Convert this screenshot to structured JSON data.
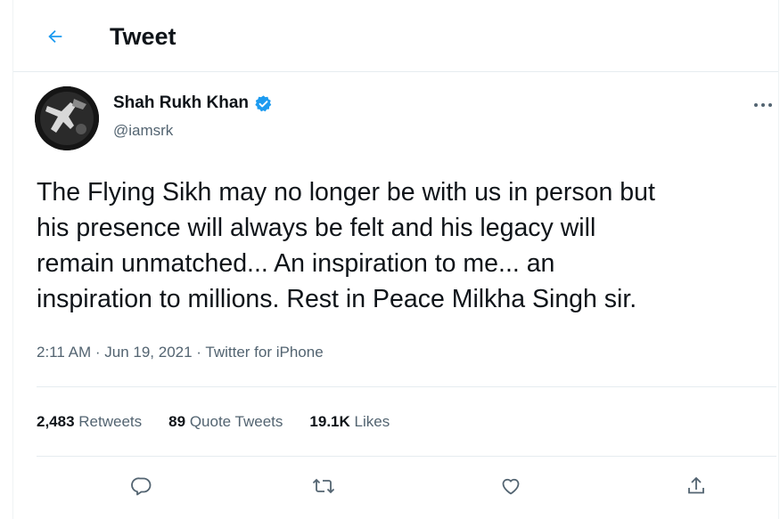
{
  "header": {
    "title": "Tweet",
    "back_icon": "arrow-left-icon"
  },
  "tweet": {
    "author_name": "Shah Rukh Khan",
    "author_handle": "@iamsrk",
    "verified": true,
    "text_lines": [
      "The Flying Sikh may no longer be with us in person but",
      "his presence will always be felt and his legacy will",
      "remain unmatched... An inspiration to me... an",
      "inspiration to millions. Rest in Peace Milkha Singh sir."
    ],
    "time": "2:11 AM",
    "date": "Jun 19, 2021",
    "source": "Twitter for iPhone"
  },
  "stats": {
    "retweets_count": "2,483",
    "retweets_label": "Retweets",
    "quotes_count": "89",
    "quotes_label": "Quote Tweets",
    "likes_count": "19.1K",
    "likes_label": "Likes"
  },
  "actions": [
    "reply-icon",
    "retweet-icon",
    "like-icon",
    "share-icon"
  ],
  "colors": {
    "accent": "#1d9bf0",
    "text": "#0f1419",
    "secondary": "#536471",
    "divider": "#e6ecf0"
  }
}
